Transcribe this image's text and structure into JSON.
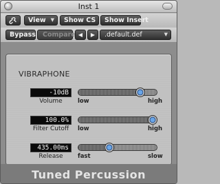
{
  "window": {
    "title": "Inst 1"
  },
  "toolbar": {
    "link_icon": "link-icon",
    "view_label": "View",
    "show_cs_label": "Show CS",
    "show_insert_label": "Show Insert",
    "bypass_label": "Bypass",
    "compare_label": "Compare",
    "prev_label": "◀",
    "next_label": "▶",
    "preset_label": ".default.def"
  },
  "plugin": {
    "instrument_name": "VIBRAPHONE",
    "footer_label": "Tuned Percussion",
    "params": [
      {
        "name": "Volume",
        "value": "-10dB",
        "min_label": "low",
        "max_label": "high",
        "level": 0.82
      },
      {
        "name": "Filter Cutoff",
        "value": "100.0%",
        "min_label": "low",
        "max_label": "high",
        "level": 1.0
      },
      {
        "name": "Release",
        "value": "435.00ms",
        "min_label": "fast",
        "max_label": "slow",
        "level": 0.38
      }
    ]
  }
}
